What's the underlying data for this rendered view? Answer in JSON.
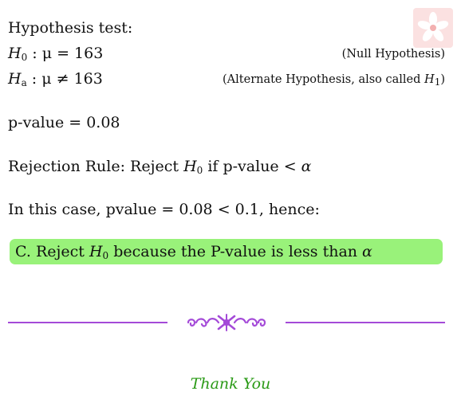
{
  "title": "Hypothesis test:",
  "h0": {
    "sym": "H",
    "sub": "0",
    "expr": ": μ = 163",
    "note": "(Null Hypothesis)"
  },
  "ha": {
    "sym": "H",
    "sub": "a",
    "expr": ": μ ≠ 163",
    "note_prefix": "(Alternate Hypothesis, also called ",
    "note_sym": "H",
    "note_sub": "1",
    "note_suffix": ")"
  },
  "pvalue_line": "p-value = 0.08",
  "rejection": {
    "prefix": "Rejection Rule: Reject ",
    "sym": "H",
    "sub": "0",
    "suffix_text": " if p-value < ",
    "alpha": "α"
  },
  "case_line": "In this case, pvalue = 0.08 < 0.1, hence:",
  "answer": {
    "prefix": "C. Reject ",
    "sym": "H",
    "sub": "0",
    "middle": " because the P-value is less than ",
    "alpha": "α"
  },
  "footer": {
    "thanks": "Thank You"
  },
  "colors": {
    "answer_bg": "#99f27a",
    "divider": "#a44ad8",
    "thanks": "#2a9a16",
    "logo": "#f7c7c7"
  }
}
